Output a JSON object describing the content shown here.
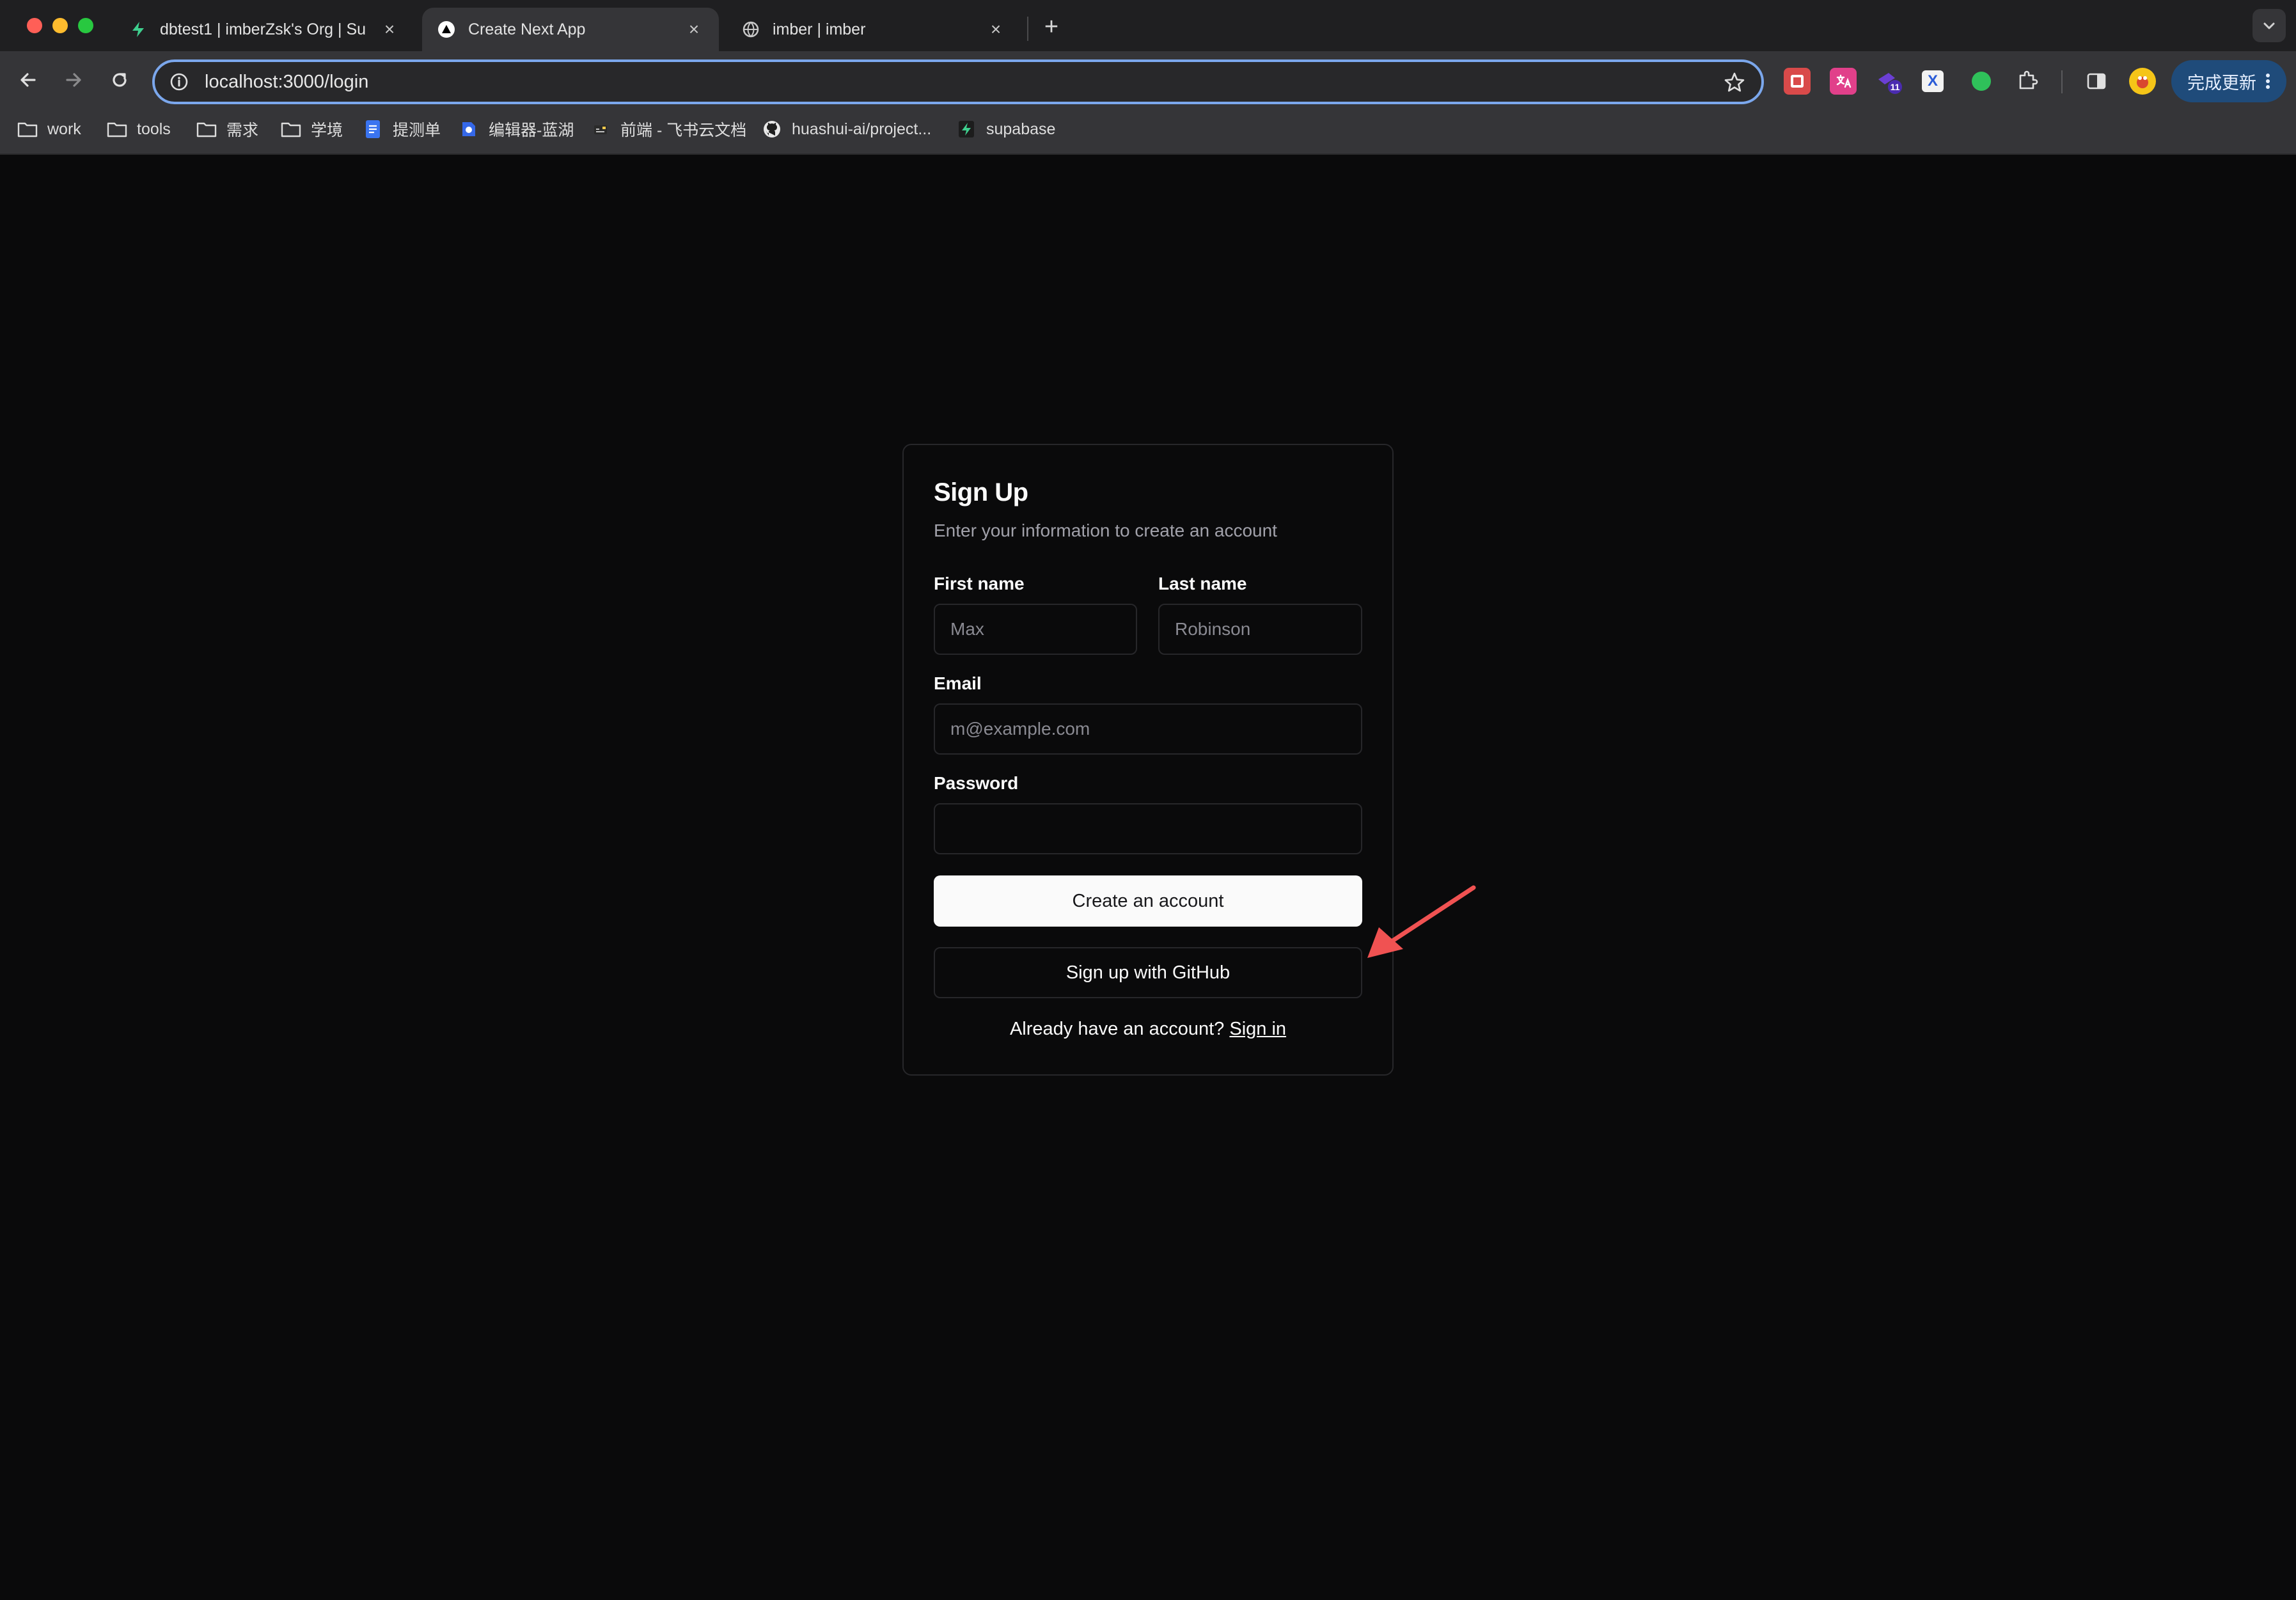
{
  "browser": {
    "tabs": [
      {
        "title": "dbtest1 | imberZsk's Org | Su",
        "icon": "supabase-bolt-icon"
      },
      {
        "title": "Create Next App",
        "icon": "nextjs-triangle-icon"
      },
      {
        "title": "imber | imber",
        "icon": "globe-icon"
      }
    ],
    "close_glyph": "×",
    "new_tab_glyph": "+",
    "url": "localhost:3000/login",
    "update_button": "完成更新",
    "extension_badge": "11",
    "extension_x_label": "X",
    "bookmarks": [
      {
        "label": "work",
        "icon": "folder-icon"
      },
      {
        "label": "tools",
        "icon": "folder-icon"
      },
      {
        "label": "需求",
        "icon": "folder-icon"
      },
      {
        "label": "学境",
        "icon": "folder-icon"
      },
      {
        "label": "提测单",
        "icon": "doc-icon"
      },
      {
        "label": "编辑器-蓝湖",
        "icon": "lanhu-icon"
      },
      {
        "label": "前端 - 飞书云文档",
        "icon": "feishu-icon"
      },
      {
        "label": "huashui-ai/project...",
        "icon": "github-icon"
      },
      {
        "label": "supabase",
        "icon": "supabase-bolt-icon"
      }
    ]
  },
  "form": {
    "title": "Sign Up",
    "subtitle": "Enter your information to create an account",
    "first_name_label": "First name",
    "first_name_placeholder": "Max",
    "last_name_label": "Last name",
    "last_name_placeholder": "Robinson",
    "email_label": "Email",
    "email_placeholder": "m@example.com",
    "password_label": "Password",
    "create_button": "Create an account",
    "github_button": "Sign up with GitHub",
    "already_text": "Already have an account? ",
    "sign_in_link": "Sign in"
  },
  "colors": {
    "page_bg": "#0a0a0b",
    "card_border": "#27272a",
    "primary_button_bg": "#fafafa",
    "annotation_arrow": "#f05252",
    "omnibox_focus": "#7ba7ec"
  }
}
